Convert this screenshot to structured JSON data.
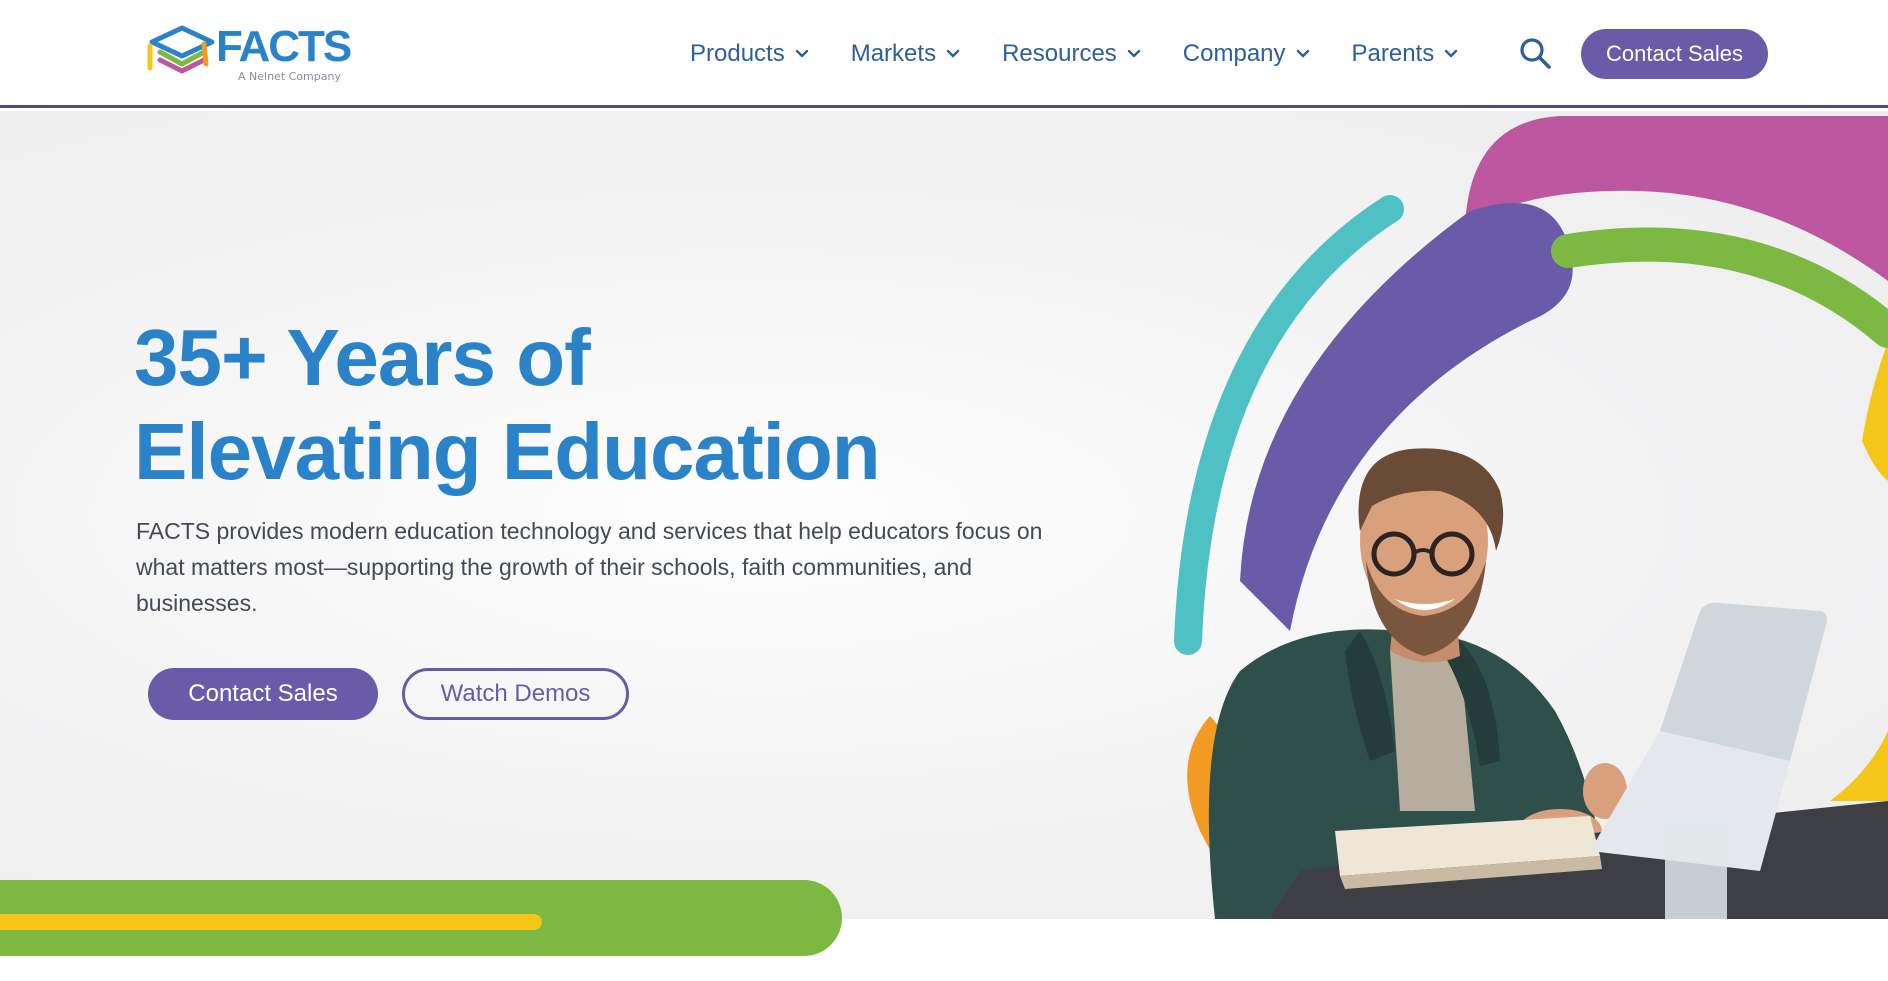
{
  "brand": {
    "name": "FACTS",
    "tagline": "A Nelnet Company"
  },
  "nav": {
    "items": [
      {
        "label": "Products"
      },
      {
        "label": "Markets"
      },
      {
        "label": "Resources"
      },
      {
        "label": "Company"
      },
      {
        "label": "Parents"
      }
    ],
    "contact_label": "Contact Sales"
  },
  "hero": {
    "title_line1": "35+ Years of",
    "title_line2": "Elevating Education",
    "description": "FACTS provides modern education technology and services that help educators focus on what matters most—supporting the growth of their schools, faith communities, and businesses.",
    "primary_label": "Contact Sales",
    "secondary_label": "Watch Demos"
  },
  "icons": {
    "search": "search-icon",
    "chevron": "chevron-down-icon"
  },
  "colors": {
    "brand_blue": "#2a83c9",
    "nav_blue": "#2d5f99",
    "purple": "#6a5ba8",
    "magenta": "#bd57a0",
    "teal": "#4fc1c4",
    "green": "#7db843",
    "yellow": "#f5c518",
    "orange": "#f39a25"
  }
}
